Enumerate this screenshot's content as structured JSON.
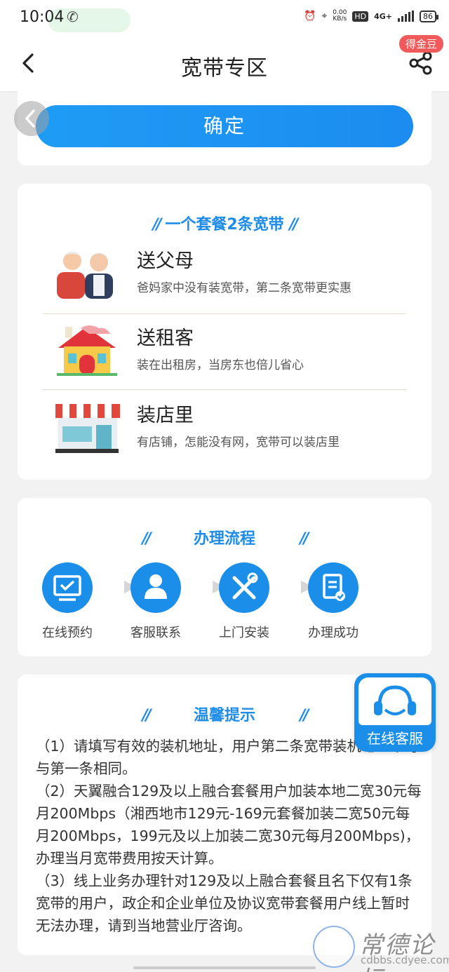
{
  "status_bar": {
    "time": "10:04",
    "net_speed": "0.00",
    "net_unit": "KB/s",
    "hd": "HD",
    "signal": "4G+",
    "battery": "86"
  },
  "header": {
    "title": "宽带专区",
    "badge": "得金豆"
  },
  "confirm": {
    "label": "确定"
  },
  "package_section": {
    "title": "一个套餐2条宽带",
    "items": [
      {
        "title": "送父母",
        "desc": "爸妈家中没有装宽带，第二条宽带更实惠",
        "icon": "elderly-couple-icon"
      },
      {
        "title": "送租客",
        "desc": "装在出租房，当房东也倍儿省心",
        "icon": "house-icon"
      },
      {
        "title": "装店里",
        "desc": "有店铺，怎能没有网，宽带可以装店里",
        "icon": "shop-icon"
      }
    ]
  },
  "process_section": {
    "title": "办理流程",
    "steps": [
      {
        "label": "在线预约",
        "icon": "monitor-check-icon"
      },
      {
        "label": "客服联系",
        "icon": "person-icon"
      },
      {
        "label": "上门安装",
        "icon": "tools-icon"
      },
      {
        "label": "办理成功",
        "icon": "clipboard-check-icon"
      }
    ]
  },
  "tips_section": {
    "title": "温馨提示",
    "paragraphs": [
      "（1）请填写有效的装机地址，用户第二条宽带装机地址不可与第一条相同。",
      "（2）天翼融合129及以上融合套餐用户加装本地二宽30元每月200Mbps（湘西地市129元-169元套餐加装二宽50元每月200Mbps，199元及以上加装二宽30元每月200Mbps)，办理当月宽带费用按天计算。",
      "（3）线上业务办理针对129及以上融合套餐且名下仅有1条宽带的用户，政企和企业单位及协议宽带套餐用户线上暂时无法办理，请到当地营业厅咨询。"
    ]
  },
  "customer_service": {
    "label": "在线客服"
  },
  "watermark": {
    "title": "常德论坛",
    "url": "cdbbs.cdyee.com"
  },
  "colors": {
    "primary": "#1a8ee9",
    "badge": "#f05a5a",
    "background": "#f2f2f2"
  }
}
